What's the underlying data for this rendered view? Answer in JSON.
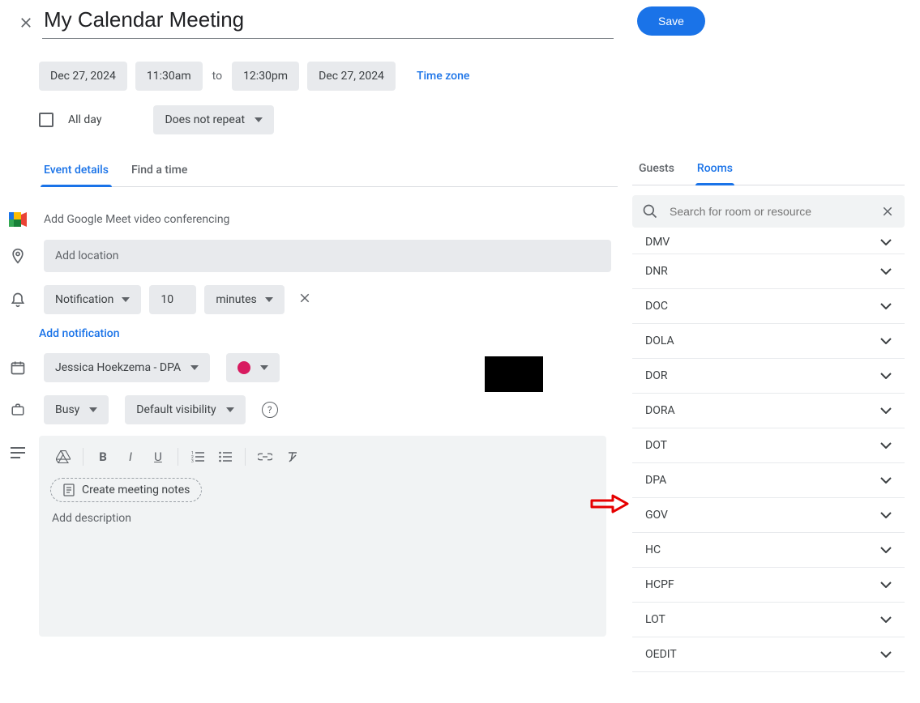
{
  "header": {
    "title": "My Calendar Meeting",
    "save_label": "Save"
  },
  "datetime": {
    "start_date": "Dec 27, 2024",
    "start_time": "11:30am",
    "to_label": "to",
    "end_time": "12:30pm",
    "end_date": "Dec 27, 2024",
    "timezone_label": "Time zone"
  },
  "allday": {
    "label": "All day",
    "repeat_label": "Does not repeat"
  },
  "tabs": {
    "event_details": "Event details",
    "find_a_time": "Find a time"
  },
  "details": {
    "meet_label": "Add Google Meet video conferencing",
    "location_placeholder": "Add location",
    "notification": {
      "type_label": "Notification",
      "value": "10",
      "unit_label": "minutes"
    },
    "add_notification_label": "Add notification",
    "owner_label": "Jessica Hoekzema - DPA",
    "busy_label": "Busy",
    "visibility_label": "Default visibility",
    "color": "#d81b60",
    "meeting_notes_label": "Create meeting notes",
    "description_placeholder": "Add description"
  },
  "right": {
    "tabs": {
      "guests": "Guests",
      "rooms": "Rooms"
    },
    "search_placeholder": "Search for room or resource",
    "rooms": [
      "DMV",
      "DNR",
      "DOC",
      "DOLA",
      "DOR",
      "DORA",
      "DOT",
      "DPA",
      "GOV",
      "HC",
      "HCPF",
      "LOT",
      "OEDIT"
    ]
  }
}
